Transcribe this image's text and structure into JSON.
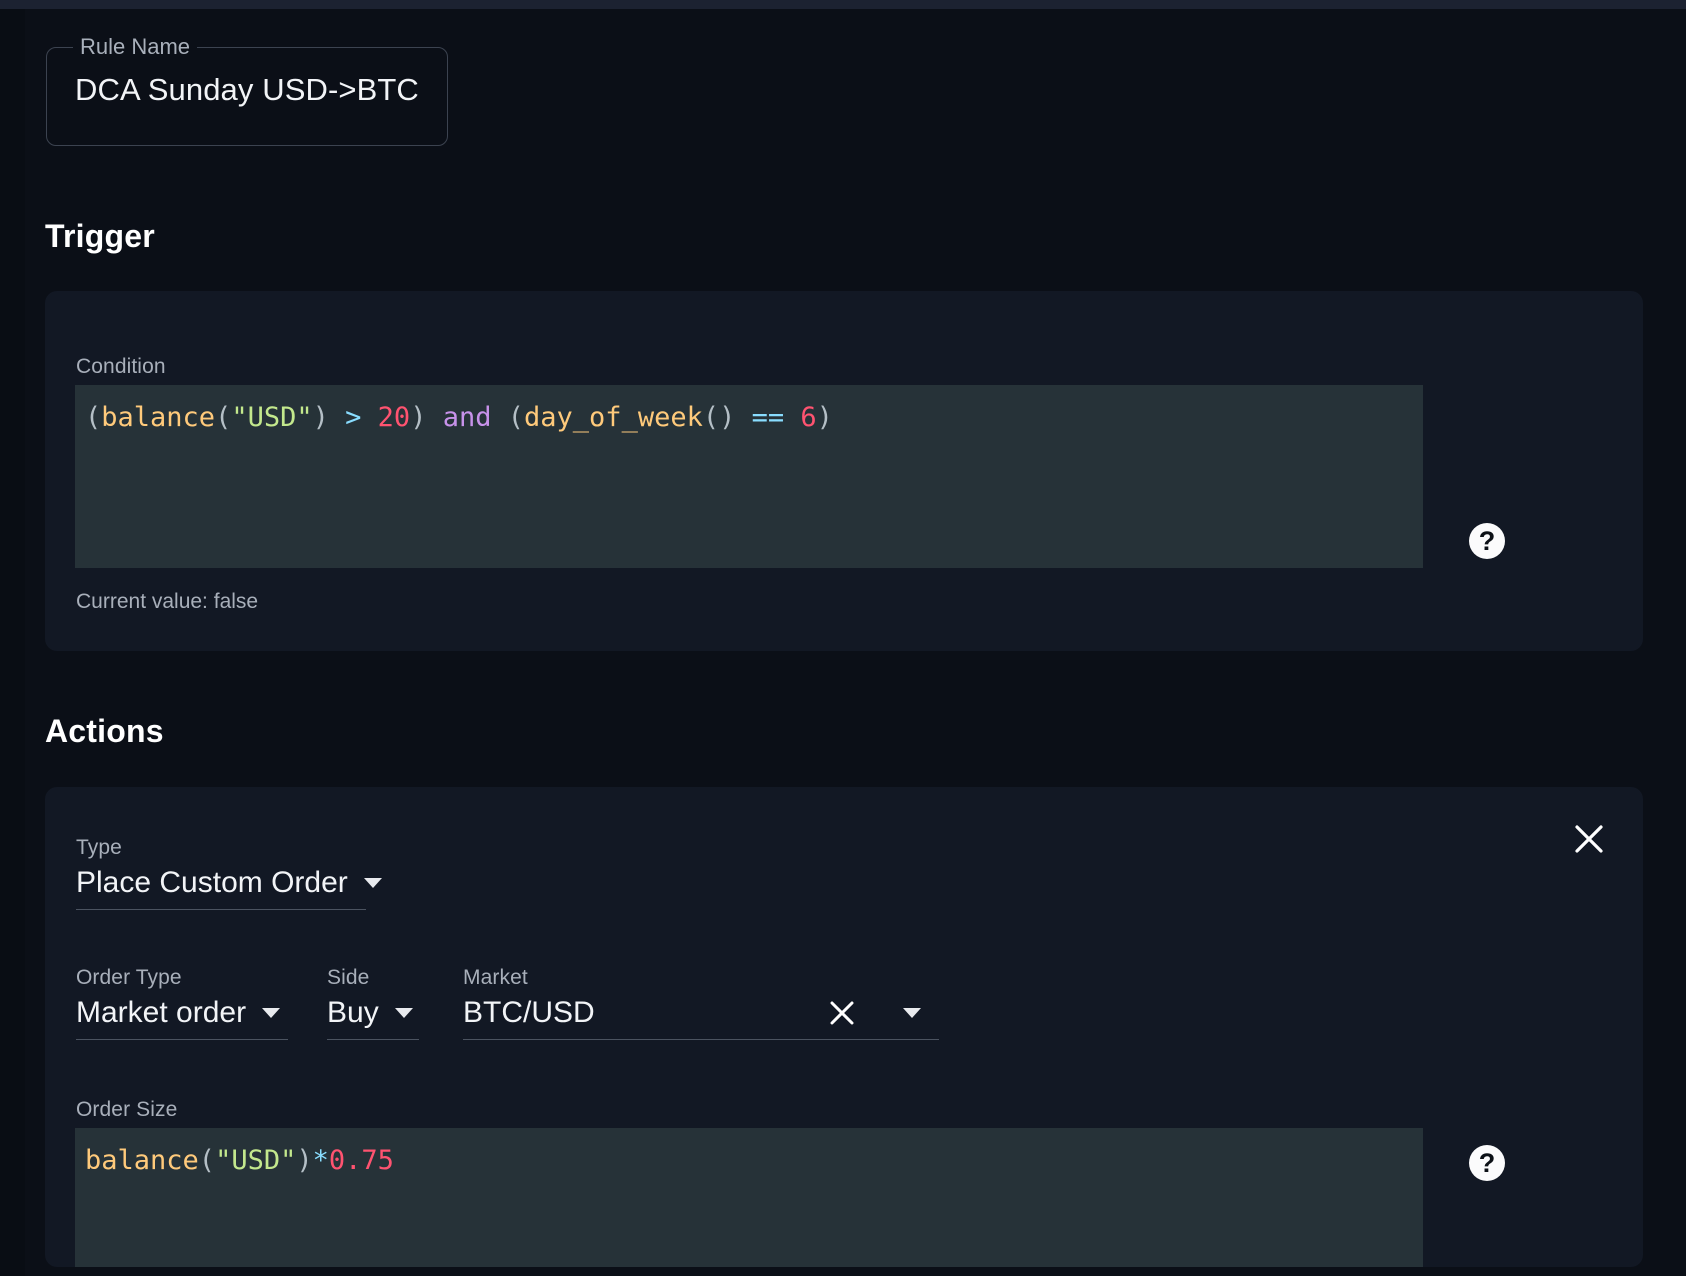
{
  "rule": {
    "name_label": "Rule Name",
    "name_value": "DCA  Sunday USD->BTC"
  },
  "trigger": {
    "title": "Trigger",
    "condition_label": "Condition",
    "condition_code": {
      "t1": "(",
      "t2": "balance",
      "t3": "(",
      "t4": "\"USD\"",
      "t5": ")",
      "t6": ">",
      "t7": "20",
      "t8": ")",
      "t9": "and",
      "t10": "(",
      "t11": "day_of_week",
      "t12": "()",
      "t13": "==",
      "t14": "6",
      "t15": ")"
    },
    "current_value_text": "Current value: false",
    "help_glyph": "?"
  },
  "actions": {
    "title": "Actions",
    "close_icon_name": "close-icon",
    "type_label": "Type",
    "type_value": "Place Custom Order",
    "order_type_label": "Order Type",
    "order_type_value": "Market order",
    "side_label": "Side",
    "side_value": "Buy",
    "market_label": "Market",
    "market_value": "BTC/USD",
    "order_size_label": "Order Size",
    "order_size_code": {
      "t1": "balance",
      "t2": "(",
      "t3": "\"USD\"",
      "t4": ")",
      "t5": "*",
      "t6": "0.75"
    },
    "help_glyph": "?"
  },
  "colors": {
    "page_background": "#0b0f17",
    "card_background": "#121824",
    "code_background": "#263238",
    "accent_text": "#f2f4f7",
    "muted_text": "#a8afba",
    "token_function": "#ffca7b",
    "token_string": "#c3e88d",
    "token_operator": "#89ddff",
    "token_number": "#ff5370",
    "token_keyword": "#c792ea",
    "token_paren": "#b4bfc6"
  }
}
